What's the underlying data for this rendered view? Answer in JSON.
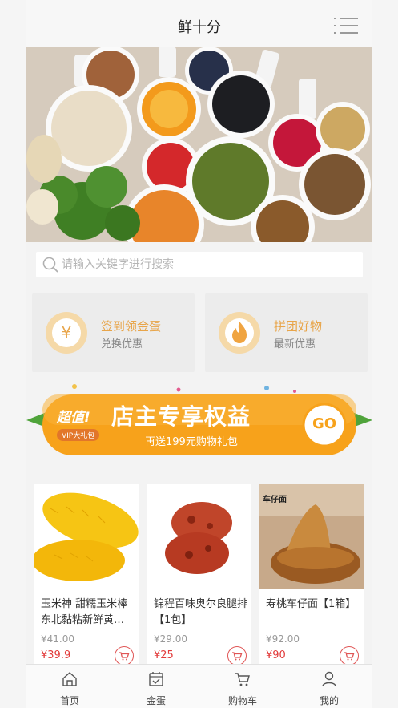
{
  "header": {
    "title": "鲜十分",
    "menu_icon": "list-menu-icon"
  },
  "search": {
    "placeholder": "请输入关键字进行搜索",
    "icon": "search-icon"
  },
  "features": [
    {
      "title": "签到领金蛋",
      "subtitle": "兑换优惠",
      "icon": "yen-coin-icon",
      "glyph": "¥"
    },
    {
      "title": "拼团好物",
      "subtitle": "最新优惠",
      "icon": "flame-icon"
    }
  ],
  "promo": {
    "badge": "超值!",
    "badge_sub": "VIP大礼包",
    "title": "店主专享权益",
    "subtitle": "再送199元购物礼包",
    "button": "GO"
  },
  "products": [
    {
      "name": "玉米神 甜糯玉米棒东北黏粘新鲜黄…",
      "original_price": "¥41.00",
      "price": "¥39.9"
    },
    {
      "name": "锦程百味奥尔良腿排【1包】",
      "original_price": "¥29.00",
      "price": "¥25"
    },
    {
      "name": "寿桃车仔面【1箱】",
      "original_price": "¥92.00",
      "price": "¥90",
      "image_label": "车仔面"
    }
  ],
  "tabs": [
    {
      "label": "首页",
      "icon": "home-icon"
    },
    {
      "label": "金蛋",
      "icon": "calendar-check-icon"
    },
    {
      "label": "购物车",
      "icon": "cart-icon"
    },
    {
      "label": "我的",
      "icon": "user-icon"
    }
  ],
  "colors": {
    "accent": "#e8a54a",
    "price": "#e23b3b",
    "promo": "#f7a21b"
  }
}
